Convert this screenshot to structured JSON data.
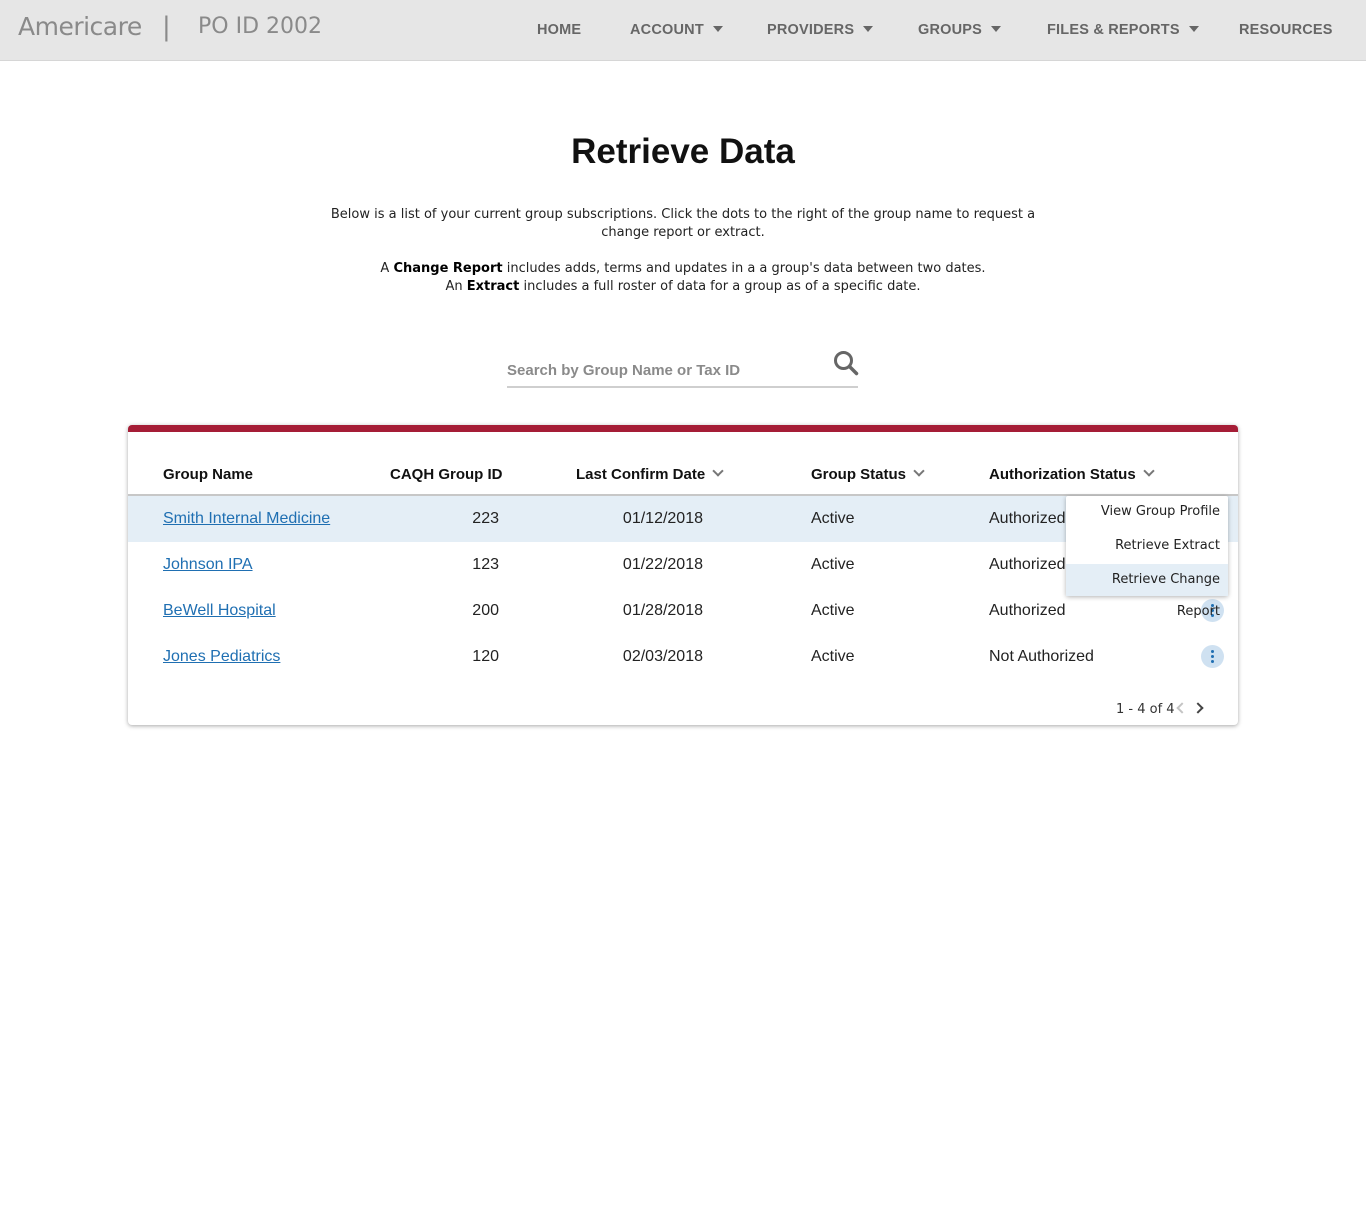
{
  "header": {
    "brand": "Americare",
    "separator": "|",
    "po_id": "PO ID 2002",
    "nav": [
      {
        "label": "HOME",
        "dropdown": false
      },
      {
        "label": "ACCOUNT",
        "dropdown": true
      },
      {
        "label": "PROVIDERS",
        "dropdown": true
      },
      {
        "label": "GROUPS",
        "dropdown": true
      },
      {
        "label": "FILES & REPORTS",
        "dropdown": true
      },
      {
        "label": "RESOURCES",
        "dropdown": false
      }
    ]
  },
  "page": {
    "title": "Retrieve Data",
    "intro": "Below is a list of your current group subscriptions. Click the dots to the right of the group name to request a change report or extract.",
    "def1": {
      "pre": "A ",
      "term": "Change Report",
      "post": " includes adds, terms and updates in a a group's data between two dates."
    },
    "def2": {
      "pre": "An ",
      "term": "Extract",
      "post": " includes a full roster of data for a group as of a specific date."
    }
  },
  "search": {
    "placeholder": "Search by Group Name or Tax ID",
    "value": ""
  },
  "table": {
    "columns": [
      "Group Name",
      "CAQH Group ID",
      "Last Confirm Date",
      "Group Status",
      "Authorization Status"
    ],
    "rows": [
      {
        "name": "Smith Internal Medicine",
        "id": "223",
        "date": "01/12/2018",
        "status": "Active",
        "auth": "Authorized"
      },
      {
        "name": "Johnson IPA",
        "id": "123",
        "date": "01/22/2018",
        "status": "Active",
        "auth": "Authorized"
      },
      {
        "name": "BeWell Hospital",
        "id": "200",
        "date": "01/28/2018",
        "status": "Active",
        "auth": "Authorized"
      },
      {
        "name": "Jones Pediatrics",
        "id": "120",
        "date": "02/03/2018",
        "status": "Active",
        "auth": "Not Authorized"
      }
    ],
    "pagination": "1 - 4 of 4"
  },
  "row_menu": {
    "items": [
      "View Group Profile",
      "Retrieve Extract",
      "Retrieve Change Report"
    ],
    "active_index": 2
  },
  "colors": {
    "accent": "#a51d36",
    "link": "#1f6fb2",
    "highlight": "#e4eef6"
  }
}
